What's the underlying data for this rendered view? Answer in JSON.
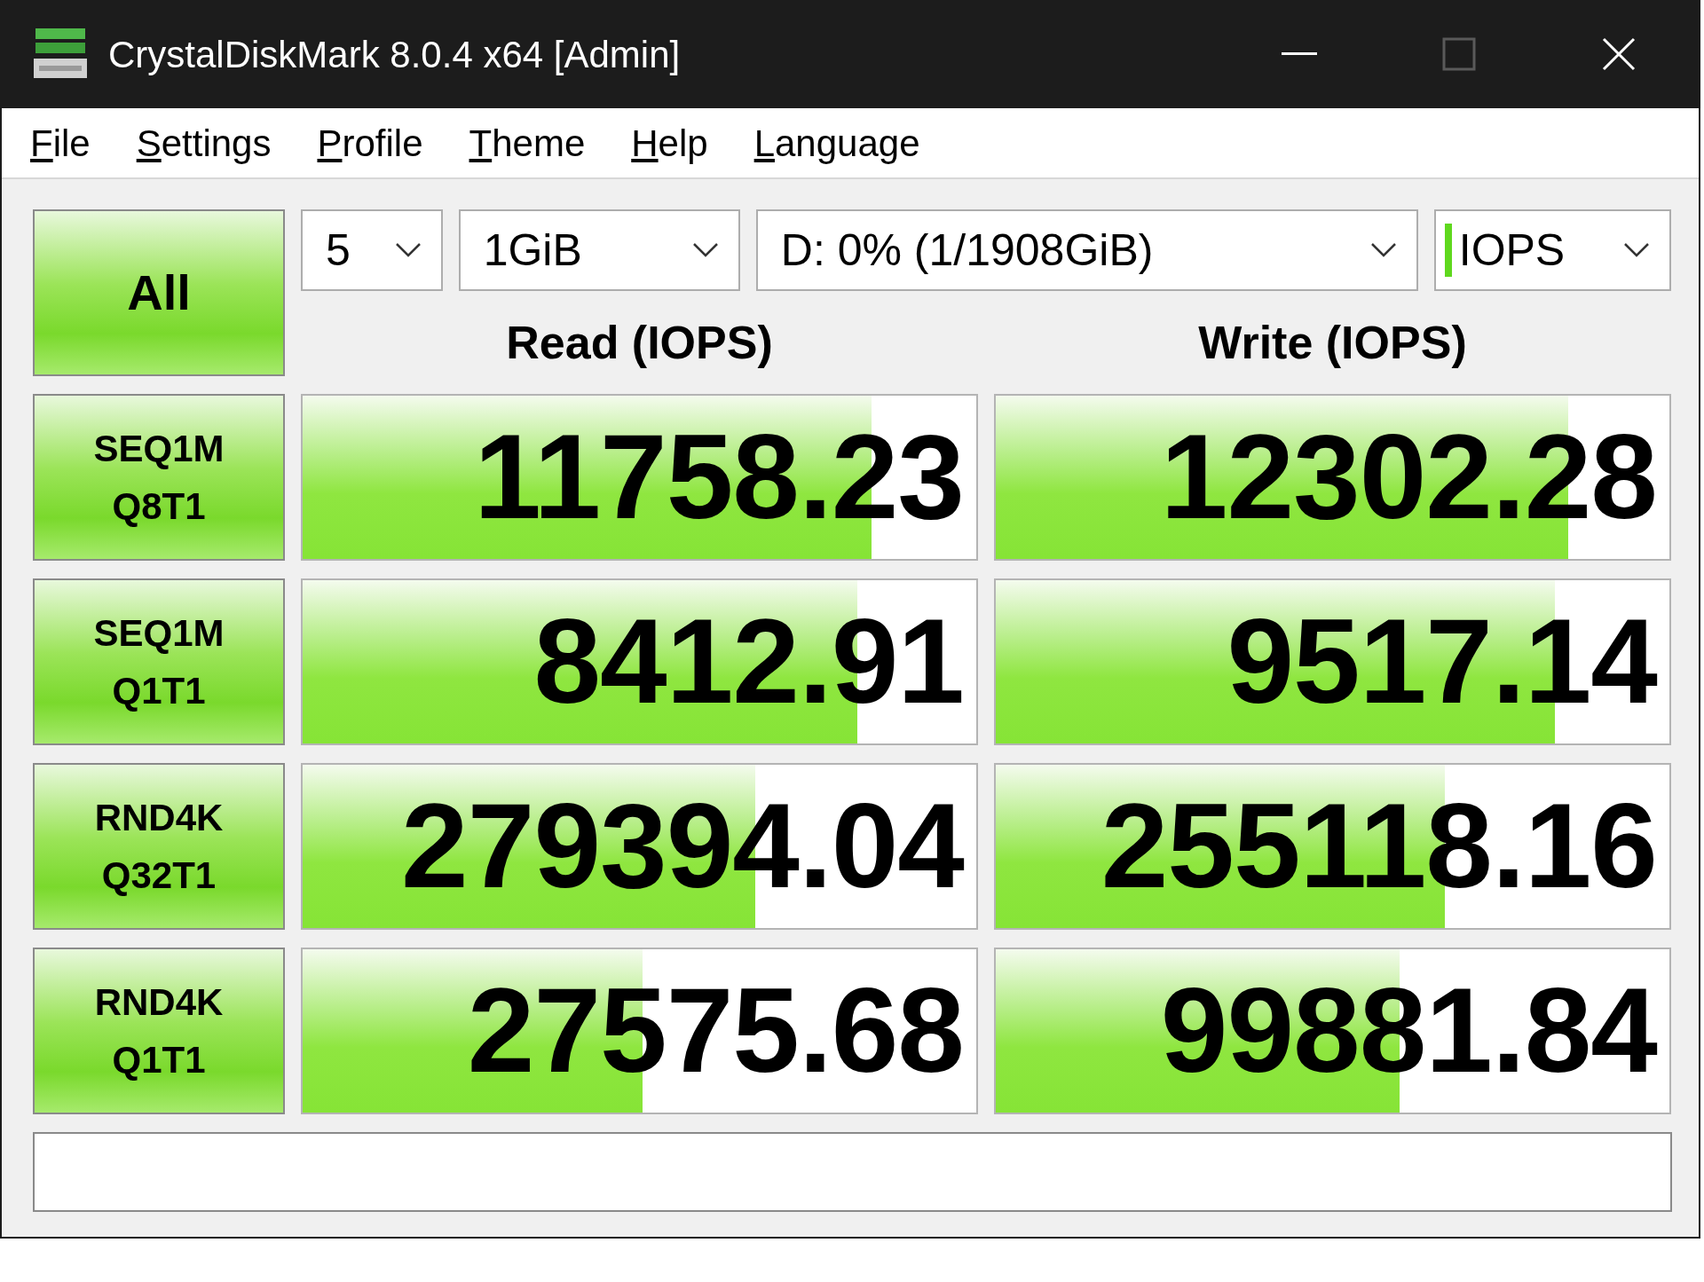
{
  "window": {
    "title": "CrystalDiskMark 8.0.4 x64 [Admin]",
    "maximize_disabled": true
  },
  "menu": [
    "File",
    "Settings",
    "Profile",
    "Theme",
    "Help",
    "Language"
  ],
  "all_button": "All",
  "selects": [
    {
      "kind": "count",
      "value": "5"
    },
    {
      "kind": "size",
      "value": "1GiB"
    },
    {
      "kind": "drive",
      "value": "D: 0% (1/1908GiB)"
    },
    {
      "kind": "unit",
      "value": "IOPS"
    }
  ],
  "headers": [
    "Read (IOPS)",
    "Write (IOPS)"
  ],
  "rows": [
    {
      "test": "SEQ1M",
      "params": "Q8T1",
      "read": {
        "value": "11758.23",
        "level": 0.844
      },
      "write": {
        "value": "12302.28",
        "level": 0.85
      }
    },
    {
      "test": "SEQ1M",
      "params": "Q1T1",
      "read": {
        "value": "8412.91",
        "level": 0.823
      },
      "write": {
        "value": "9517.14",
        "level": 0.83
      }
    },
    {
      "test": "RND4K",
      "params": "Q32T1",
      "read": {
        "value": "279394.04",
        "level": 0.672
      },
      "write": {
        "value": "255118.16",
        "level": 0.667
      }
    },
    {
      "test": "RND4K",
      "params": "Q1T1",
      "read": {
        "value": "27575.68",
        "level": 0.504
      },
      "write": {
        "value": "99881.84",
        "level": 0.6
      }
    }
  ]
}
